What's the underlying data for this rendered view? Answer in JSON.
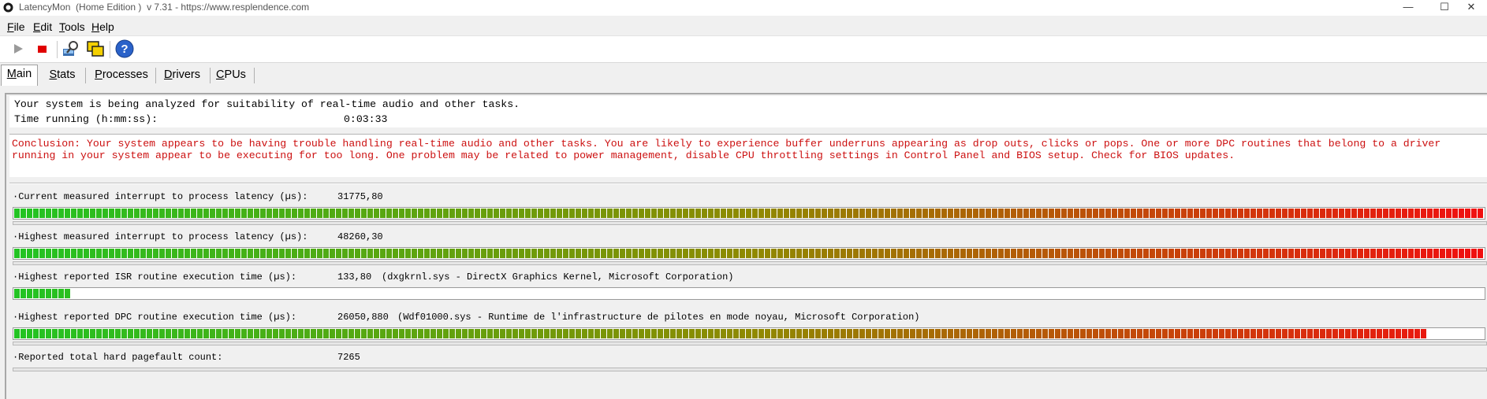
{
  "window": {
    "title": "LatencyMon  (Home Edition )  v 7.31 - https://www.resplendence.com",
    "minimize_glyph": "—",
    "maximize_glyph": "☐",
    "close_glyph": "✕"
  },
  "menu": [
    {
      "key": "F",
      "rest": "ile"
    },
    {
      "key": "E",
      "rest": "dit"
    },
    {
      "key": "T",
      "rest": "ools"
    },
    {
      "key": "H",
      "rest": "elp"
    }
  ],
  "toolbar": {
    "icons": [
      "play-icon",
      "stop-icon",
      "analyze-icon",
      "windows-icon",
      "help-icon"
    ]
  },
  "tabs": [
    {
      "key": "M",
      "rest": "ain",
      "active": true
    },
    {
      "key": "S",
      "rest": "tats",
      "active": false
    },
    {
      "key": "P",
      "rest": "rocesses",
      "active": false
    },
    {
      "key": "D",
      "rest": "rivers",
      "active": false
    },
    {
      "key": "C",
      "rest": "PUs",
      "active": false
    }
  ],
  "status": {
    "analysis_text": "Your system is being analyzed for suitability of real-time audio and other tasks.",
    "time_label": "Time running (h:mm:ss):",
    "time_value": "0:03:33"
  },
  "conclusion": "Conclusion: Your system appears to be having trouble handling real-time audio and other tasks. You are likely to experience buffer underruns appearing as drop outs, clicks or pops. One or more DPC routines that belong to a driver running in your system appear to be executing for too long. One problem may be related to power management, disable CPU throttling settings in Control Panel and BIOS setup. Check for BIOS updates.",
  "colors": {
    "conclusion_text": "#cc1010",
    "bar_low": "#22c322",
    "bar_mid": "#8f8a00",
    "bar_high": "#f01010"
  },
  "metrics": [
    {
      "label": "·Current measured interrupt to process latency (µs):",
      "value": "31775,80",
      "desc": "",
      "fill_fraction": 1.0
    },
    {
      "label": "·Highest measured interrupt to process latency (µs):",
      "value": "48260,30",
      "desc": "",
      "fill_fraction": 1.0
    },
    {
      "label": "·Highest reported ISR routine execution time (µs):",
      "value": "133,80",
      "desc": "(dxgkrnl.sys - DirectX Graphics Kernel, Microsoft Corporation)",
      "fill_fraction": 0.038
    },
    {
      "label": "·Highest reported DPC routine execution time (µs):",
      "value": "26050,880",
      "desc": "(Wdf01000.sys - Runtime de l'infrastructure de pilotes en mode noyau, Microsoft Corporation)",
      "fill_fraction": 0.962
    },
    {
      "label": "·Reported total hard pagefault count:",
      "value": "7265",
      "desc": "",
      "fill_fraction": null
    }
  ]
}
